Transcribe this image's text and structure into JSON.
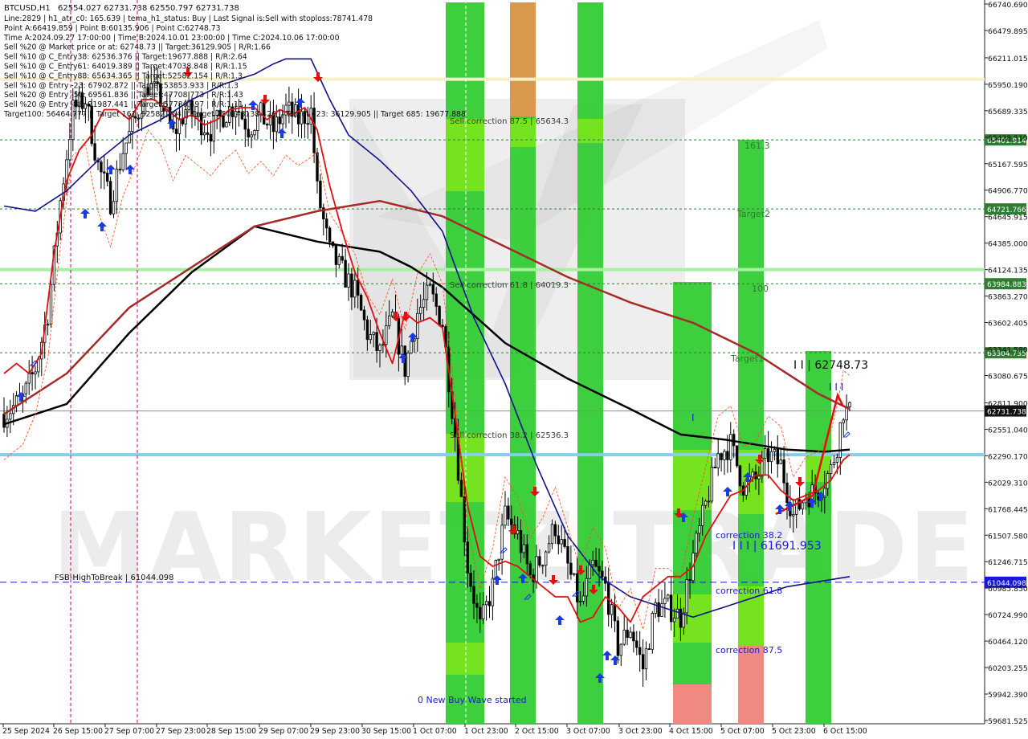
{
  "symbol": "BTCUSD,H1",
  "header": {
    "quote": "62554.027 62731.738 62550.797 62731.738",
    "lines": [
      "Line:2829 | h1_atr_c0: 165.639 | tema_h1_status: Buy | Last Signal is:Sell with stoploss:78741.478",
      "Point A:66419.859 | Point B:60135.906 | Point C:62748.73",
      "Time A:2024.09.27 17:00:00 | Time B:2024.10.01 23:00:00 | Time C:2024.10.06 17:00:00",
      "Sell %20 @ Market price or at: 62748.73 || Target:36129.905 | R/R:1.66",
      "Sell %10 @ C_Entry38: 62536.376 || Target:19677.888 | R/R:2.64",
      "Sell %10 @ C_Entry61: 64019.389 || Target:47038.848 | R/R:1.15",
      "Sell %10 @ C_Entry88: 65634.365 || Target:52582.154 | R/R:1.3",
      "Sell %10 @ Entry -23: 67902.872 || Target:53853.933 | R/R:1.3",
      "Sell %20 @ Entry -50: 69561.836 || Target:47708.773 | R/R:1.43",
      "Sell %20 @ Entry -88: 71987.441 || Target:57786.497 | R/R:1.11",
      "Target100: 56464.777 || Target 161: 52582.154 || Target 250: 48138.426 || Target 423: 36129.905 || Target 685: 19677.888"
    ]
  },
  "watermark": "MARKETZITRADE",
  "price_axis": {
    "ticks": [
      "66740.690",
      "66479.895",
      "66211.015",
      "65950.190",
      "65689.335",
      "65428.510",
      "65167.595",
      "64906.770",
      "64645.915",
      "64385.000",
      "64124.135",
      "63863.270",
      "63602.405",
      "63341.580",
      "63080.675",
      "62811.900",
      "62551.040",
      "62290.170",
      "62029.310",
      "61768.445",
      "61507.580",
      "61246.715",
      "60985.850",
      "60724.990",
      "60464.120",
      "60203.255",
      "59942.390",
      "59681.525"
    ],
    "tick_values": [
      66740.69,
      66479.895,
      66211.015,
      65950.19,
      65689.335,
      65428.51,
      65167.595,
      64906.77,
      64645.915,
      64385.0,
      64124.135,
      63863.27,
      63602.405,
      63341.58,
      63080.675,
      62811.9,
      62551.04,
      62290.17,
      62029.31,
      61768.445,
      61507.58,
      61246.715,
      60985.85,
      60724.99,
      60464.12,
      60203.255,
      59942.39,
      59681.525
    ]
  },
  "time_axis": {
    "labels": [
      "25 Sep 2024",
      "26 Sep 15:00",
      "27 Sep 07:00",
      "27 Sep 23:00",
      "28 Sep 15:00",
      "29 Sep 07:00",
      "29 Sep 23:00",
      "30 Sep 15:00",
      "1 Oct 07:00",
      "1 Oct 23:00",
      "2 Oct 15:00",
      "3 Oct 07:00",
      "3 Oct 23:00",
      "4 Oct 15:00",
      "5 Oct 07:00",
      "5 Oct 23:00",
      "6 Oct 15:00"
    ]
  },
  "levels": [
    {
      "id": "l65401",
      "value": 65401.914,
      "label": "65401.914",
      "color": "#2e7d32",
      "style": "dotted",
      "tag": true
    },
    {
      "id": "l64721",
      "value": 64721.766,
      "label": "64721.766",
      "color": "#2e7d32",
      "style": "dotted",
      "tag": true
    },
    {
      "id": "l63984",
      "value": 63984.883,
      "label": "63984.883",
      "color": "#2e7d32",
      "style": "dotted",
      "tag": true
    },
    {
      "id": "l63304",
      "value": 63304.735,
      "label": "63304.735",
      "color": "#2e7d32",
      "style": "dotted",
      "tag": true
    },
    {
      "id": "l62731",
      "value": 62731.738,
      "label": "62731.738",
      "color": "#7f8c9e",
      "style": "solid",
      "tag": true,
      "tag_bg": "#111111"
    },
    {
      "id": "l61044",
      "value": 61044.098,
      "label": "61044.098",
      "color": "#1a1ad6",
      "style": "dashed",
      "tag": true,
      "tag_bg": "#1a1ad6"
    },
    {
      "id": "l66000",
      "value": 66000,
      "label": "",
      "color": "#f4f0c8",
      "style": "band",
      "tag": false
    },
    {
      "id": "l64124",
      "value": 64124,
      "label": "",
      "color": "#a6f0a0",
      "style": "band",
      "tag": false
    },
    {
      "id": "l62290",
      "value": 62300,
      "label": "",
      "color": "#87ceeb",
      "style": "band",
      "tag": false
    }
  ],
  "fsb_label": "FSB-HighToBreak | 61044.098",
  "annotations": {
    "sell_corr_875": "Sell correction 87.5 | 65634.3",
    "sell_corr_618": "Sell correction 61.8 | 64019.3",
    "sell_corr_382": "Sell correction 38.2 | 62536.3",
    "t1613": "161.3",
    "target2": "Target2",
    "t100": "100",
    "target1": "Target1",
    "point_c": "I I | 62748.73",
    "three_bars": "I I I",
    "one_bar": "I",
    "corr382": "correction 38.2",
    "corr618": "correction 61.8",
    "corr875": "correction 87.5",
    "b_value": "I I I | 61691.953",
    "new_wave": "0 New Buy Wave started"
  },
  "colors": {
    "green_bright": "#33cc33",
    "green_light": "#7fe61a",
    "orange": "#d99a4e",
    "salmon": "#f08a80",
    "sma_black": "#000000",
    "sma_brown": "#a52a2a",
    "ema_red": "#e01010",
    "blue_line": "#10108c",
    "candle": "#000000"
  },
  "chart_data": {
    "type": "line",
    "title": "BTCUSD,H1",
    "ylim": [
      59681.525,
      66740.69
    ],
    "series": [
      {
        "key": "price",
        "values": [
          [
            0,
            62700
          ],
          [
            6,
            62850
          ],
          [
            10,
            63150
          ],
          [
            14,
            63700
          ],
          [
            18,
            64800
          ],
          [
            22,
            65700
          ],
          [
            26,
            65800
          ],
          [
            30,
            65150
          ],
          [
            34,
            64800
          ],
          [
            38,
            65300
          ],
          [
            42,
            65600
          ],
          [
            46,
            65950
          ],
          [
            50,
            65800
          ],
          [
            54,
            65450
          ],
          [
            58,
            65700
          ],
          [
            62,
            65600
          ],
          [
            66,
            65500
          ],
          [
            70,
            65650
          ],
          [
            74,
            65750
          ],
          [
            78,
            65520
          ],
          [
            82,
            65640
          ],
          [
            86,
            65500
          ],
          [
            90,
            65700
          ],
          [
            94,
            65600
          ],
          [
            98,
            65680
          ],
          [
            100,
            64900
          ],
          [
            104,
            64300
          ],
          [
            108,
            64100
          ],
          [
            112,
            63900
          ],
          [
            116,
            63500
          ],
          [
            120,
            63300
          ],
          [
            124,
            63650
          ],
          [
            128,
            63150
          ],
          [
            132,
            63700
          ],
          [
            136,
            63900
          ],
          [
            140,
            63600
          ],
          [
            144,
            62500
          ],
          [
            148,
            61200
          ],
          [
            152,
            60600
          ],
          [
            156,
            61000
          ],
          [
            160,
            61700
          ],
          [
            164,
            61500
          ],
          [
            168,
            61100
          ],
          [
            172,
            61300
          ],
          [
            176,
            61600
          ],
          [
            180,
            61200
          ],
          [
            184,
            60800
          ],
          [
            188,
            61200
          ],
          [
            192,
            61000
          ],
          [
            196,
            60400
          ],
          [
            200,
            60600
          ],
          [
            204,
            60200
          ],
          [
            208,
            60800
          ],
          [
            212,
            60800
          ],
          [
            216,
            60700
          ],
          [
            220,
            61300
          ],
          [
            224,
            61800
          ],
          [
            228,
            62300
          ],
          [
            232,
            62400
          ],
          [
            236,
            62000
          ],
          [
            240,
            62050
          ],
          [
            244,
            62300
          ],
          [
            248,
            62200
          ],
          [
            252,
            61700
          ],
          [
            256,
            61900
          ],
          [
            260,
            61950
          ],
          [
            264,
            62150
          ],
          [
            266,
            62400
          ],
          [
            268,
            62750
          ],
          [
            270,
            62700
          ]
        ]
      },
      {
        "key": "sma_black",
        "values": [
          [
            0,
            62600
          ],
          [
            20,
            62800
          ],
          [
            40,
            63500
          ],
          [
            60,
            64100
          ],
          [
            80,
            64550
          ],
          [
            100,
            64400
          ],
          [
            120,
            64300
          ],
          [
            130,
            64150
          ],
          [
            140,
            63950
          ],
          [
            160,
            63400
          ],
          [
            180,
            63050
          ],
          [
            200,
            62750
          ],
          [
            216,
            62500
          ],
          [
            230,
            62450
          ],
          [
            250,
            62350
          ],
          [
            262,
            62330
          ],
          [
            270,
            62350
          ]
        ]
      },
      {
        "key": "sma_brown",
        "values": [
          [
            0,
            62700
          ],
          [
            20,
            63100
          ],
          [
            40,
            63750
          ],
          [
            60,
            64150
          ],
          [
            80,
            64550
          ],
          [
            100,
            64700
          ],
          [
            120,
            64800
          ],
          [
            140,
            64650
          ],
          [
            160,
            64350
          ],
          [
            180,
            64050
          ],
          [
            200,
            63800
          ],
          [
            220,
            63600
          ],
          [
            240,
            63300
          ],
          [
            260,
            62900
          ],
          [
            270,
            62750
          ]
        ]
      },
      {
        "key": "ema_red",
        "values": [
          [
            0,
            63100
          ],
          [
            4,
            63200
          ],
          [
            8,
            63100
          ],
          [
            12,
            63300
          ],
          [
            16,
            64300
          ],
          [
            20,
            65000
          ],
          [
            24,
            65300
          ],
          [
            28,
            65450
          ],
          [
            32,
            65700
          ],
          [
            36,
            65700
          ],
          [
            40,
            65600
          ],
          [
            44,
            65800
          ],
          [
            48,
            65800
          ],
          [
            52,
            65700
          ],
          [
            56,
            65600
          ],
          [
            60,
            65650
          ],
          [
            64,
            65550
          ],
          [
            68,
            65600
          ],
          [
            72,
            65700
          ],
          [
            76,
            65720
          ],
          [
            80,
            65720
          ],
          [
            84,
            65600
          ],
          [
            88,
            65700
          ],
          [
            92,
            65650
          ],
          [
            96,
            65720
          ],
          [
            100,
            65500
          ],
          [
            104,
            64950
          ],
          [
            108,
            64500
          ],
          [
            112,
            64100
          ],
          [
            116,
            63850
          ],
          [
            120,
            63500
          ],
          [
            124,
            63200
          ],
          [
            128,
            63700
          ],
          [
            132,
            63600
          ],
          [
            136,
            63650
          ],
          [
            140,
            63550
          ],
          [
            144,
            62700
          ],
          [
            148,
            61800
          ],
          [
            152,
            61300
          ],
          [
            156,
            61200
          ],
          [
            160,
            61250
          ],
          [
            164,
            61200
          ],
          [
            168,
            61100
          ],
          [
            172,
            61000
          ],
          [
            176,
            60900
          ],
          [
            180,
            60900
          ],
          [
            184,
            60650
          ],
          [
            188,
            60700
          ],
          [
            192,
            60900
          ],
          [
            196,
            60800
          ],
          [
            200,
            60650
          ],
          [
            204,
            60900
          ],
          [
            208,
            61000
          ],
          [
            212,
            61100
          ],
          [
            216,
            61100
          ],
          [
            220,
            61200
          ],
          [
            224,
            61500
          ],
          [
            228,
            61700
          ],
          [
            232,
            61900
          ],
          [
            236,
            61950
          ],
          [
            240,
            62100
          ],
          [
            244,
            62100
          ],
          [
            248,
            61950
          ],
          [
            252,
            61850
          ],
          [
            256,
            61900
          ],
          [
            260,
            61950
          ],
          [
            264,
            62050
          ],
          [
            268,
            62250
          ],
          [
            270,
            62300
          ]
        ]
      },
      {
        "key": "blue_line",
        "values": [
          [
            0,
            64750
          ],
          [
            10,
            64700
          ],
          [
            20,
            64900
          ],
          [
            30,
            65200
          ],
          [
            40,
            65450
          ],
          [
            50,
            65600
          ],
          [
            60,
            65800
          ],
          [
            70,
            65950
          ],
          [
            80,
            66050
          ],
          [
            86,
            66150
          ],
          [
            90,
            66200
          ],
          [
            98,
            66200
          ],
          [
            104,
            65800
          ],
          [
            110,
            65450
          ],
          [
            120,
            65200
          ],
          [
            130,
            64900
          ],
          [
            140,
            64500
          ],
          [
            150,
            63650
          ],
          [
            160,
            63000
          ],
          [
            170,
            62200
          ],
          [
            180,
            61500
          ],
          [
            190,
            61100
          ],
          [
            200,
            60900
          ],
          [
            210,
            60800
          ],
          [
            220,
            60700
          ],
          [
            230,
            60800
          ],
          [
            240,
            60900
          ],
          [
            250,
            61000
          ],
          [
            260,
            61050
          ],
          [
            270,
            61100
          ]
        ]
      }
    ],
    "zones": [
      {
        "label": "Sell correction 87.5 | 65634.3",
        "value": 65634.3
      },
      {
        "label": "Sell correction 61.8 | 64019.3",
        "value": 64019.3
      },
      {
        "label": "Sell correction 38.2 | 62536.3",
        "value": 62536.3
      }
    ]
  }
}
